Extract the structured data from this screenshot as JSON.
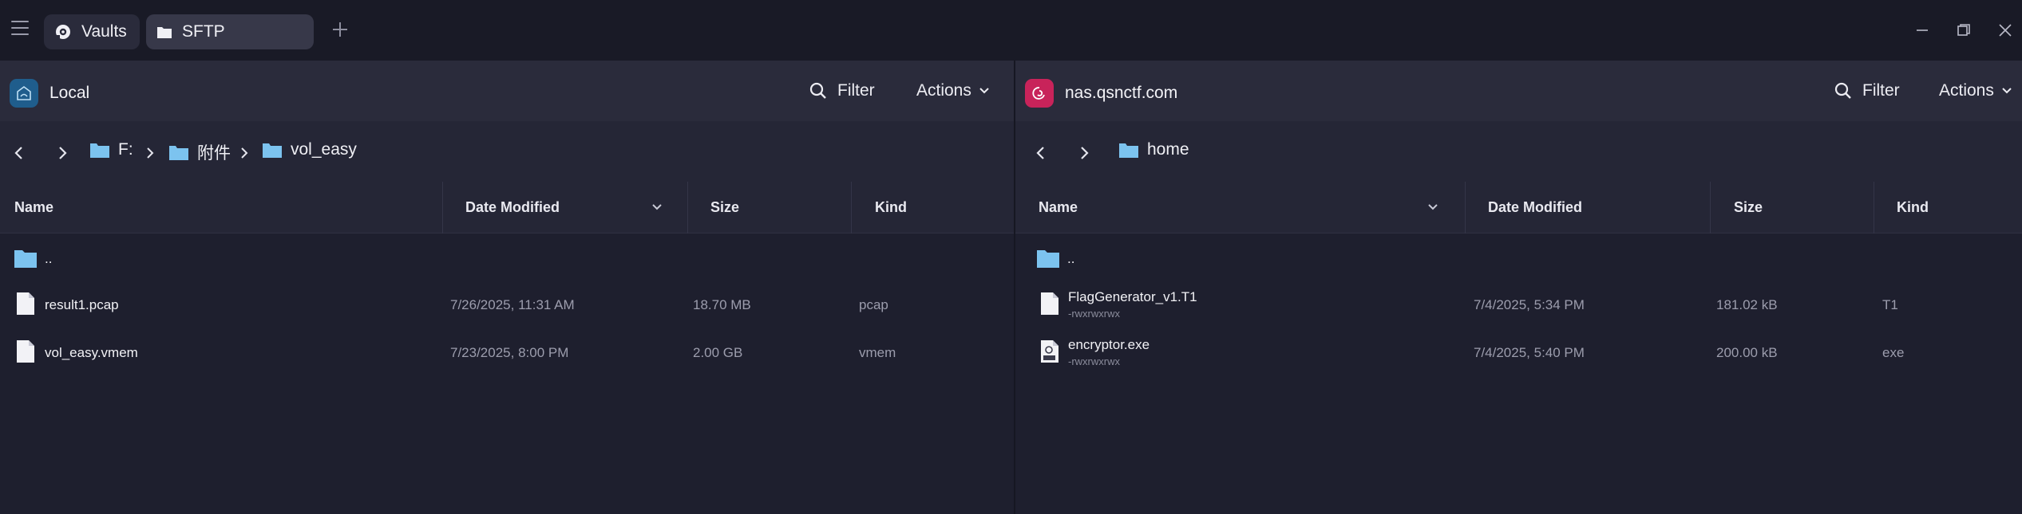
{
  "tabs": [
    {
      "label": "Vaults",
      "icon": "vault-icon"
    },
    {
      "label": "SFTP",
      "icon": "folder-icon"
    }
  ],
  "colors": {
    "folder": "#7cc3ef",
    "local_badge": "#1f5d8c",
    "remote_badge": "#c8235a",
    "accent_text": "#f0f0f5"
  },
  "left": {
    "host": "Local",
    "filter_label": "Filter",
    "actions_label": "Actions",
    "breadcrumb": [
      "F:",
      "附件",
      "vol_easy"
    ],
    "columns": [
      "Name",
      "Date Modified",
      "Size",
      "Kind"
    ],
    "parent_label": "..",
    "files": [
      {
        "name": "result1.pcap",
        "date": "7/26/2025, 11:31 AM",
        "size": "18.70 MB",
        "kind": "pcap",
        "icon": "file-icon"
      },
      {
        "name": "vol_easy.vmem",
        "date": "7/23/2025, 8:00 PM",
        "size": "2.00 GB",
        "kind": "vmem",
        "icon": "file-icon"
      }
    ]
  },
  "right": {
    "host": "nas.qsnctf.com",
    "filter_label": "Filter",
    "actions_label": "Actions",
    "breadcrumb": [
      "home"
    ],
    "columns": [
      "Name",
      "Date Modified",
      "Size",
      "Kind"
    ],
    "parent_label": "..",
    "files": [
      {
        "name": "FlagGenerator_v1.T1",
        "perm": "-rwxrwxrwx",
        "date": "7/4/2025, 5:34 PM",
        "size": "181.02 kB",
        "kind": "T1",
        "icon": "file-icon"
      },
      {
        "name": "encryptor.exe",
        "perm": "-rwxrwxrwx",
        "date": "7/4/2025, 5:40 PM",
        "size": "200.00 kB",
        "kind": "exe",
        "icon": "exe-file-icon"
      }
    ]
  }
}
